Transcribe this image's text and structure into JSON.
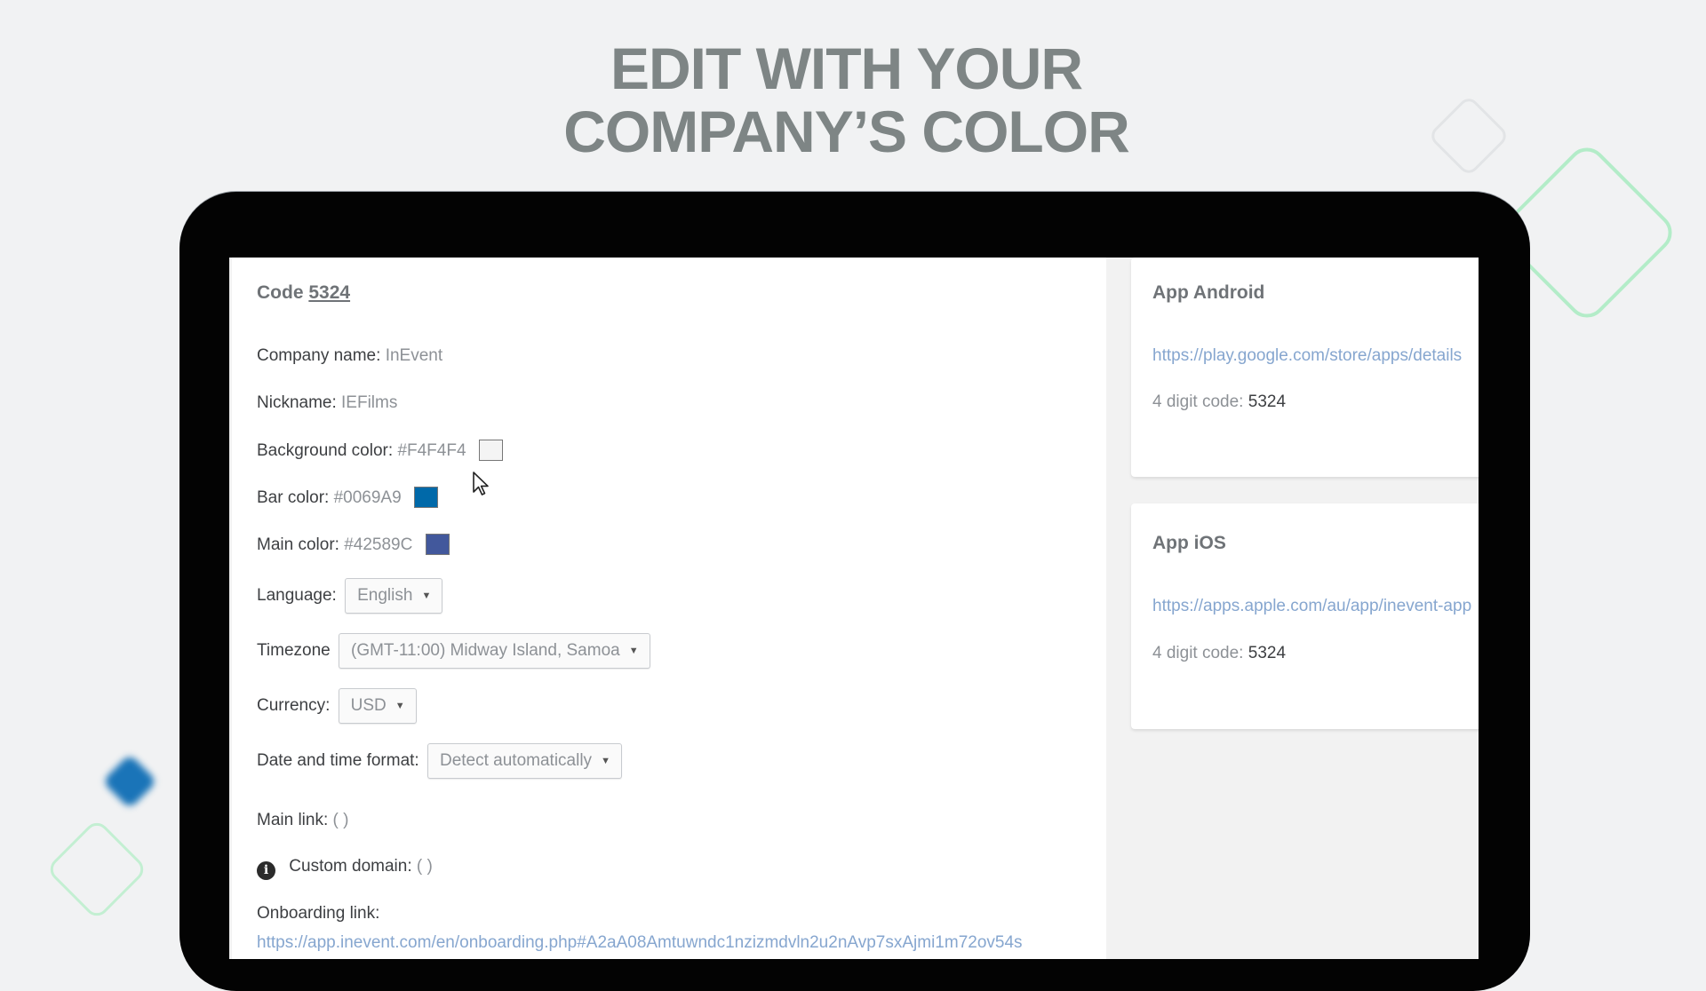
{
  "headline": {
    "line1": "EDIT WITH YOUR",
    "line2": "COMPANY’S COLOR"
  },
  "settings": {
    "code_label": "Code",
    "code_value": "5324",
    "company_name_label": "Company name:",
    "company_name_value": "InEvent",
    "nickname_label": "Nickname:",
    "nickname_value": "IEFilms",
    "background_color_label": "Background color:",
    "background_color_value": "#F4F4F4",
    "bar_color_label": "Bar color:",
    "bar_color_value": "#0069A9",
    "main_color_label": "Main color:",
    "main_color_value": "#42589C",
    "language_label": "Language:",
    "language_value": "English",
    "timezone_label": "Timezone",
    "timezone_value": "(GMT-11:00) Midway Island, Samoa",
    "currency_label": "Currency:",
    "currency_value": "USD",
    "datetime_label": "Date and time format:",
    "datetime_value": "Detect automatically",
    "main_link_label": "Main link:",
    "main_link_value": "( )",
    "custom_domain_label": "Custom domain:",
    "custom_domain_value": "( )",
    "onboarding_label": "Onboarding link:",
    "onboarding_url": "https://app.inevent.com/en/onboarding.php#A2aA08Amtuwndc1nzizmdvln2u2nAvp7sxAjmi1m72ov54s"
  },
  "android": {
    "title": "App Android",
    "url": "https://play.google.com/store/apps/details",
    "digit_label": "4 digit code:",
    "digit_value": "5324"
  },
  "ios": {
    "title": "App iOS",
    "url": "https://apps.apple.com/au/app/inevent-app",
    "digit_label": "4 digit code:",
    "digit_value": "5324"
  },
  "icons": {
    "dropdown": "caret-down-icon",
    "info": "info-icon",
    "cursor": "mouse-pointer-icon"
  },
  "colors": {
    "background": "#F4F4F4",
    "bar": "#0069A9",
    "main": "#42589C",
    "headline": "#7E8585",
    "link": "#86A6CF"
  }
}
